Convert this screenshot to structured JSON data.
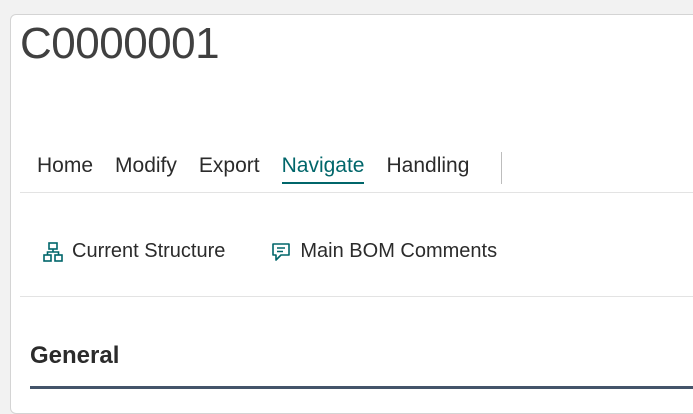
{
  "page": {
    "title": "C0000001"
  },
  "tabs": [
    {
      "label": "Home"
    },
    {
      "label": "Modify"
    },
    {
      "label": "Export"
    },
    {
      "label": "Navigate",
      "active": true
    },
    {
      "label": "Handling"
    }
  ],
  "actions": [
    {
      "label": "Current Structure",
      "icon": "hierarchy-icon"
    },
    {
      "label": "Main BOM Comments",
      "icon": "comment-icon"
    }
  ],
  "section": {
    "title": "General"
  },
  "colors": {
    "accent": "#00666a",
    "section_rule": "#44546a",
    "text": "#2b2b2b"
  }
}
